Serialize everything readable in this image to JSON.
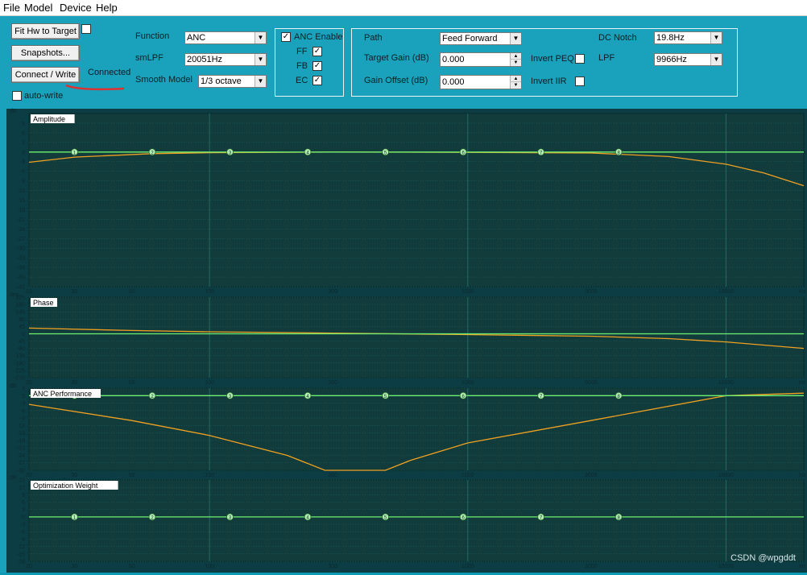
{
  "menu": {
    "file": "File",
    "model": "Model",
    "device": "Device",
    "help": "Help"
  },
  "toolbar": {
    "fit_hw_label": "Fit Hw to Target",
    "snapshots_label": "Snapshots...",
    "connect_label": "Connect / Write",
    "connected_status": "Connected",
    "auto_write_label": "auto-write",
    "function_label": "Function",
    "function_value": "ANC",
    "smlpf_label": "smLPF",
    "smlpf_value": "20051Hz",
    "smooth_label": "Smooth Model",
    "smooth_value": "1/3 octave",
    "anc_enable_label": "ANC Enable",
    "ff_label": "FF",
    "fb_label": "FB",
    "ec_label": "EC",
    "path_label": "Path",
    "path_value": "Feed Forward",
    "target_gain_label": "Target Gain (dB)",
    "target_gain_value": "0.000",
    "gain_offset_label": "Gain Offset (dB)",
    "gain_offset_value": "0.000",
    "invert_peq_label": "Invert PEQ",
    "invert_iir_label": "Invert IIR",
    "dc_notch_label": "DC Notch",
    "dc_notch_value": "19.8Hz",
    "lpf_label": "LPF",
    "lpf_value": "9966Hz",
    "check_mark": "✓"
  },
  "colors": {
    "plot_bg": "#123c3c",
    "grid": "#1e6a6a",
    "curve_orange": "#f0a020",
    "curve_green": "#70f070",
    "window_bg": "#1aa1bb",
    "connect_underline": "#e03030"
  },
  "watermark": "CSDN @wpgddt",
  "x_axis": {
    "unit": "Hz",
    "ticks": [
      {
        "v": 20,
        "label": "20"
      },
      {
        "v": 30,
        "label": "30"
      },
      {
        "v": 50,
        "label": "50"
      },
      {
        "v": 100,
        "label": "100"
      },
      {
        "v": 300,
        "label": "300"
      },
      {
        "v": 1000,
        "label": "1000"
      },
      {
        "v": 3000,
        "label": "3000"
      },
      {
        "v": 10000,
        "label": "10000"
      }
    ],
    "range": [
      20,
      20000
    ],
    "major_lines": [
      100,
      1000,
      10000
    ]
  },
  "chart_data": [
    {
      "type": "line",
      "title": "Amplitude",
      "ylabel": "dB",
      "ylim": [
        -42,
        12
      ],
      "yticks": [
        9,
        6,
        3,
        0,
        -3,
        -6,
        -9,
        -12,
        -15,
        -18,
        -21,
        -24,
        -27,
        -30,
        -33,
        -36,
        -39,
        -42
      ],
      "series": [
        {
          "color": "#f0a020",
          "x": [
            20,
            30,
            60,
            100,
            300,
            1000,
            3000,
            6000,
            10000,
            14000,
            20000
          ],
          "y": [
            -3.2,
            -1.6,
            -0.5,
            -0.2,
            0,
            -0.1,
            -0.3,
            -1.4,
            -3.8,
            -6.5,
            -10.5
          ]
        },
        {
          "color": "#70f070",
          "x": [
            20,
            20000
          ],
          "y": [
            0,
            0
          ]
        }
      ],
      "markers": {
        "x": [
          30,
          60,
          120,
          240,
          480,
          960,
          1920,
          3840
        ],
        "labels": [
          "1",
          "2",
          "3",
          "4",
          "5",
          "6",
          "7",
          "8"
        ],
        "y": 0
      }
    },
    {
      "type": "line",
      "title": "Phase",
      "ylabel": "deg",
      "ylim": [
        -270,
        225
      ],
      "yticks": [
        225,
        180,
        135,
        90,
        45,
        0,
        -45,
        -90,
        -135,
        -180,
        -225,
        -270
      ],
      "series": [
        {
          "color": "#f0a020",
          "x": [
            20,
            50,
            100,
            300,
            1000,
            3000,
            6000,
            10000,
            20000
          ],
          "y": [
            35,
            20,
            12,
            4,
            -5,
            -15,
            -30,
            -50,
            -90
          ]
        },
        {
          "color": "#70f070",
          "x": [
            20,
            20000
          ],
          "y": [
            0,
            0
          ]
        }
      ]
    },
    {
      "type": "line",
      "title": "ANC Performance",
      "ylabel": "dB",
      "ylim": [
        -30,
        3
      ],
      "yticks": [
        3,
        0,
        -3,
        -6,
        -9,
        -12,
        -15,
        -18,
        -21,
        -24,
        -27,
        -30
      ],
      "series": [
        {
          "color": "#f0a020",
          "x": [
            20,
            50,
            100,
            200,
            280,
            480,
            600,
            1000,
            3000,
            10000,
            20000
          ],
          "y": [
            -3.5,
            -10,
            -16,
            -24,
            -30,
            -30,
            -26,
            -19,
            -10,
            0,
            1
          ]
        },
        {
          "color": "#70f070",
          "x": [
            20,
            20000
          ],
          "y": [
            0,
            0
          ]
        }
      ],
      "markers": {
        "x": [
          30,
          60,
          120,
          240,
          480,
          960,
          1920,
          3840
        ],
        "labels": [
          "1",
          "2",
          "3",
          "4",
          "5",
          "6",
          "7",
          "8"
        ],
        "y": 0
      }
    },
    {
      "type": "line",
      "title": "Optimization Weight",
      "ylabel": "dB",
      "ylim": [
        -18,
        15
      ],
      "yticks": [
        15,
        12,
        9,
        6,
        3,
        0,
        -3,
        -6,
        -9,
        -12,
        -15,
        -18
      ],
      "series": [
        {
          "color": "#70f070",
          "x": [
            20,
            20000
          ],
          "y": [
            0,
            0
          ]
        }
      ],
      "markers": {
        "x": [
          30,
          60,
          120,
          240,
          480,
          960,
          1920,
          3840
        ],
        "labels": [
          "1",
          "2",
          "3",
          "4",
          "5",
          "6",
          "7",
          "8"
        ],
        "y": 0
      }
    }
  ]
}
